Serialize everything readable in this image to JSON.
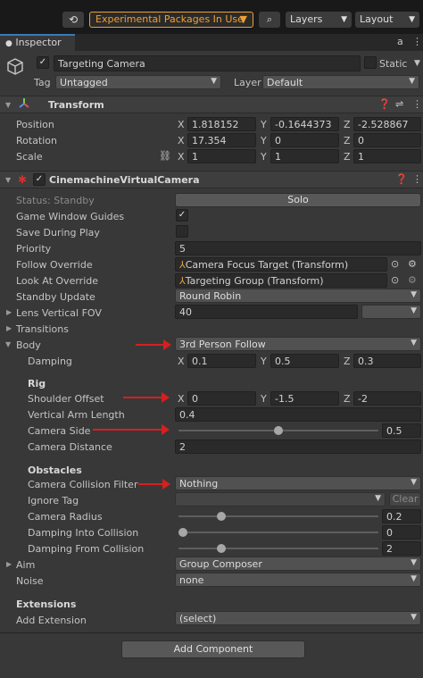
{
  "toolbar": {
    "history_icon": "history-icon",
    "packages_label": "Experimental Packages In Use",
    "search_icon": "search-icon",
    "layers_label": "Layers",
    "layout_label": "Layout"
  },
  "tab": {
    "label": "Inspector",
    "lock": "a",
    "menu": "⋮"
  },
  "object": {
    "name": "Targeting Camera",
    "static_label": "Static",
    "tag_label": "Tag",
    "tag_value": "Untagged",
    "layer_label": "Layer",
    "layer_value": "Default"
  },
  "transform": {
    "title": "Transform",
    "position_label": "Position",
    "rotation_label": "Rotation",
    "scale_label": "Scale",
    "position": {
      "x": "1.818152",
      "y": "-0.1644373",
      "z": "-2.528867"
    },
    "rotation": {
      "x": "17.354",
      "y": "0",
      "z": "0"
    },
    "scale": {
      "x": "1",
      "y": "1",
      "z": "1"
    },
    "axis_x": "X",
    "axis_y": "Y",
    "axis_z": "Z"
  },
  "vcam": {
    "title": "CinemachineVirtualCamera",
    "status": "Status: Standby",
    "solo": "Solo",
    "game_window_guides": "Game Window Guides",
    "save_during_play": "Save During Play",
    "priority_label": "Priority",
    "priority_value": "5",
    "follow_label": "Follow Override",
    "follow_value": "Camera Focus Target (Transform)",
    "lookat_label": "Look At Override",
    "lookat_value": "Targeting Group (Transform)",
    "standby_label": "Standby Update",
    "standby_value": "Round Robin",
    "lens_label": "Lens Vertical FOV",
    "lens_value": "40",
    "transitions_label": "Transitions",
    "body_label": "Body",
    "body_value": "3rd Person Follow",
    "damping_label": "Damping",
    "damping": {
      "x": "0.1",
      "y": "0.5",
      "z": "0.3"
    },
    "rig_label": "Rig",
    "shoulder_label": "Shoulder Offset",
    "shoulder": {
      "x": "0",
      "y": "-1.5",
      "z": "-2"
    },
    "arm_label": "Vertical Arm Length",
    "arm_value": "0.4",
    "side_label": "Camera Side",
    "side_value": "0.5",
    "side_fraction": 0.5,
    "distance_label": "Camera Distance",
    "distance_value": "2",
    "obstacles_label": "Obstacles",
    "collision_label": "Camera Collision Filter",
    "collision_value": "Nothing",
    "ignore_label": "Ignore Tag",
    "clear_label": "Clear",
    "radius_label": "Camera Radius",
    "radius_value": "0.2",
    "radius_fraction": 0.2,
    "damp_into_label": "Damping Into Collision",
    "damp_into_value": "0",
    "damp_into_fraction": 0.0,
    "damp_from_label": "Damping From Collision",
    "damp_from_value": "2",
    "damp_from_fraction": 0.2,
    "aim_label": "Aim",
    "aim_value": "Group Composer",
    "noise_label": "Noise",
    "noise_value": "none",
    "extensions_label": "Extensions",
    "add_ext_label": "Add Extension",
    "add_ext_value": "(select)"
  },
  "footer": {
    "add_component": "Add Component"
  },
  "colors": {
    "accent_orange": "#f0a030",
    "annotation_red": "#d61f1f",
    "background": "#383838"
  }
}
